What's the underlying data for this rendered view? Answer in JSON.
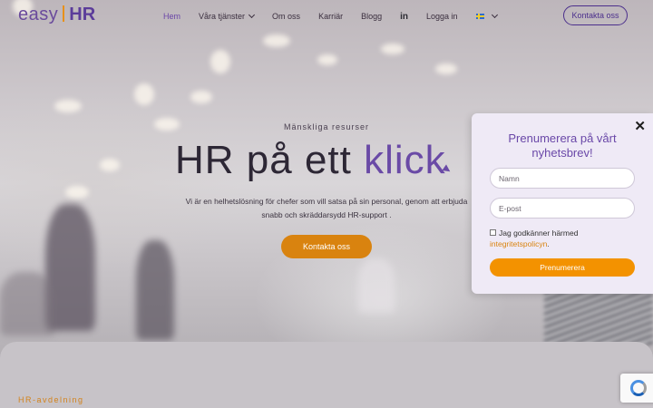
{
  "brand": {
    "logo_easy": "easy",
    "logo_hr": "HR",
    "colors": {
      "purple": "#5b3c9a",
      "orange": "#d9830f",
      "text": "#2d2735"
    }
  },
  "nav": {
    "items": [
      {
        "label": "Hem",
        "active": true,
        "has_dropdown": false
      },
      {
        "label": "Våra tjänster",
        "active": false,
        "has_dropdown": true
      },
      {
        "label": "Om oss",
        "active": false,
        "has_dropdown": false
      },
      {
        "label": "Karriär",
        "active": false,
        "has_dropdown": false
      },
      {
        "label": "Blogg",
        "active": false,
        "has_dropdown": false
      }
    ],
    "linkedin_label": "in",
    "login_label": "Logga in",
    "language_icon": "swedish-flag-icon",
    "cta_label": "Kontakta oss"
  },
  "hero": {
    "eyebrow": "Mänskliga resurser",
    "headline_main": "HR på ett ",
    "headline_accent": "klick",
    "lead": "Vi är en helhetslösning för chefer som vill satsa på sin personal, genom att erbjuda snabb och skräddarsydd HR-support .",
    "cta_label": "Kontakta oss"
  },
  "section": {
    "label": "HR-avdelning"
  },
  "newsletter": {
    "title": "Prenumerera på vårt nyhetsbrev!",
    "name_placeholder": "Namn",
    "email_placeholder": "E-post",
    "consent_text": "Jag godkänner härmed ",
    "consent_link": "integritetspolicyn",
    "consent_end": ".",
    "consent_checked": false,
    "submit_label": "Prenumerera",
    "close_icon": "close-icon"
  }
}
